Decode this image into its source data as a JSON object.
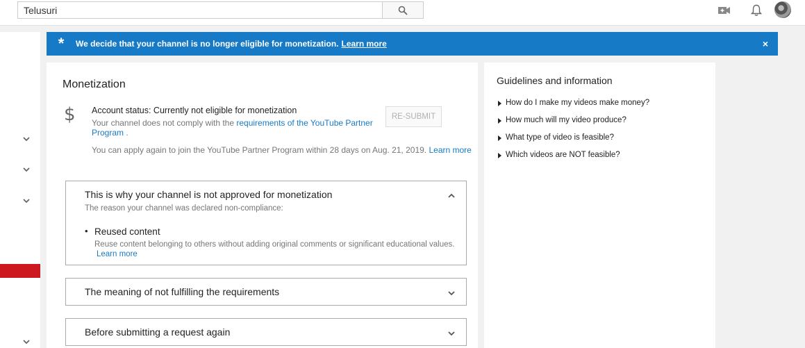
{
  "topbar": {
    "search_value": "Telusuri",
    "icons": [
      "search-icon",
      "video-camera-add-icon",
      "bell-icon",
      "avatar"
    ]
  },
  "banner": {
    "message": "We decide that your channel is no longer eligible for monetization.",
    "link": "Learn more",
    "close": "×",
    "color": "#167ac6"
  },
  "monetization": {
    "title": "Monetization",
    "status": "Account status: Currently not eligible for monetization",
    "comply_text": "Your channel does not comply with the",
    "comply_link": "requirements of the YouTube Partner Program",
    "comply_end": ".",
    "apply_text": "You can apply again to join the YouTube Partner Program within 28 days on Aug. 21, 2019.",
    "apply_link": "Learn more",
    "resubmit_label": "RE-SUBMIT"
  },
  "sections": {
    "why": {
      "title": "This is why your channel is not approved for monetization",
      "subtitle": "The reason your channel was declared non-compliance:",
      "reason_title": "Reused content",
      "reason_desc": "Reuse content belonging to others without adding original comments or significant educational values.",
      "reason_link": "Learn more"
    },
    "meaning": {
      "title": "The meaning of not fulfilling the requirements"
    },
    "before": {
      "title": "Before submitting a request again"
    }
  },
  "guidelines": {
    "title": "Guidelines and information",
    "items": [
      "How do I make my videos make money?",
      "How much will my video produce?",
      "What type of video is feasible?",
      "Which videos are NOT feasible?"
    ]
  },
  "colors": {
    "accent": "#167ac6",
    "sidebar_active": "#cc181e"
  }
}
